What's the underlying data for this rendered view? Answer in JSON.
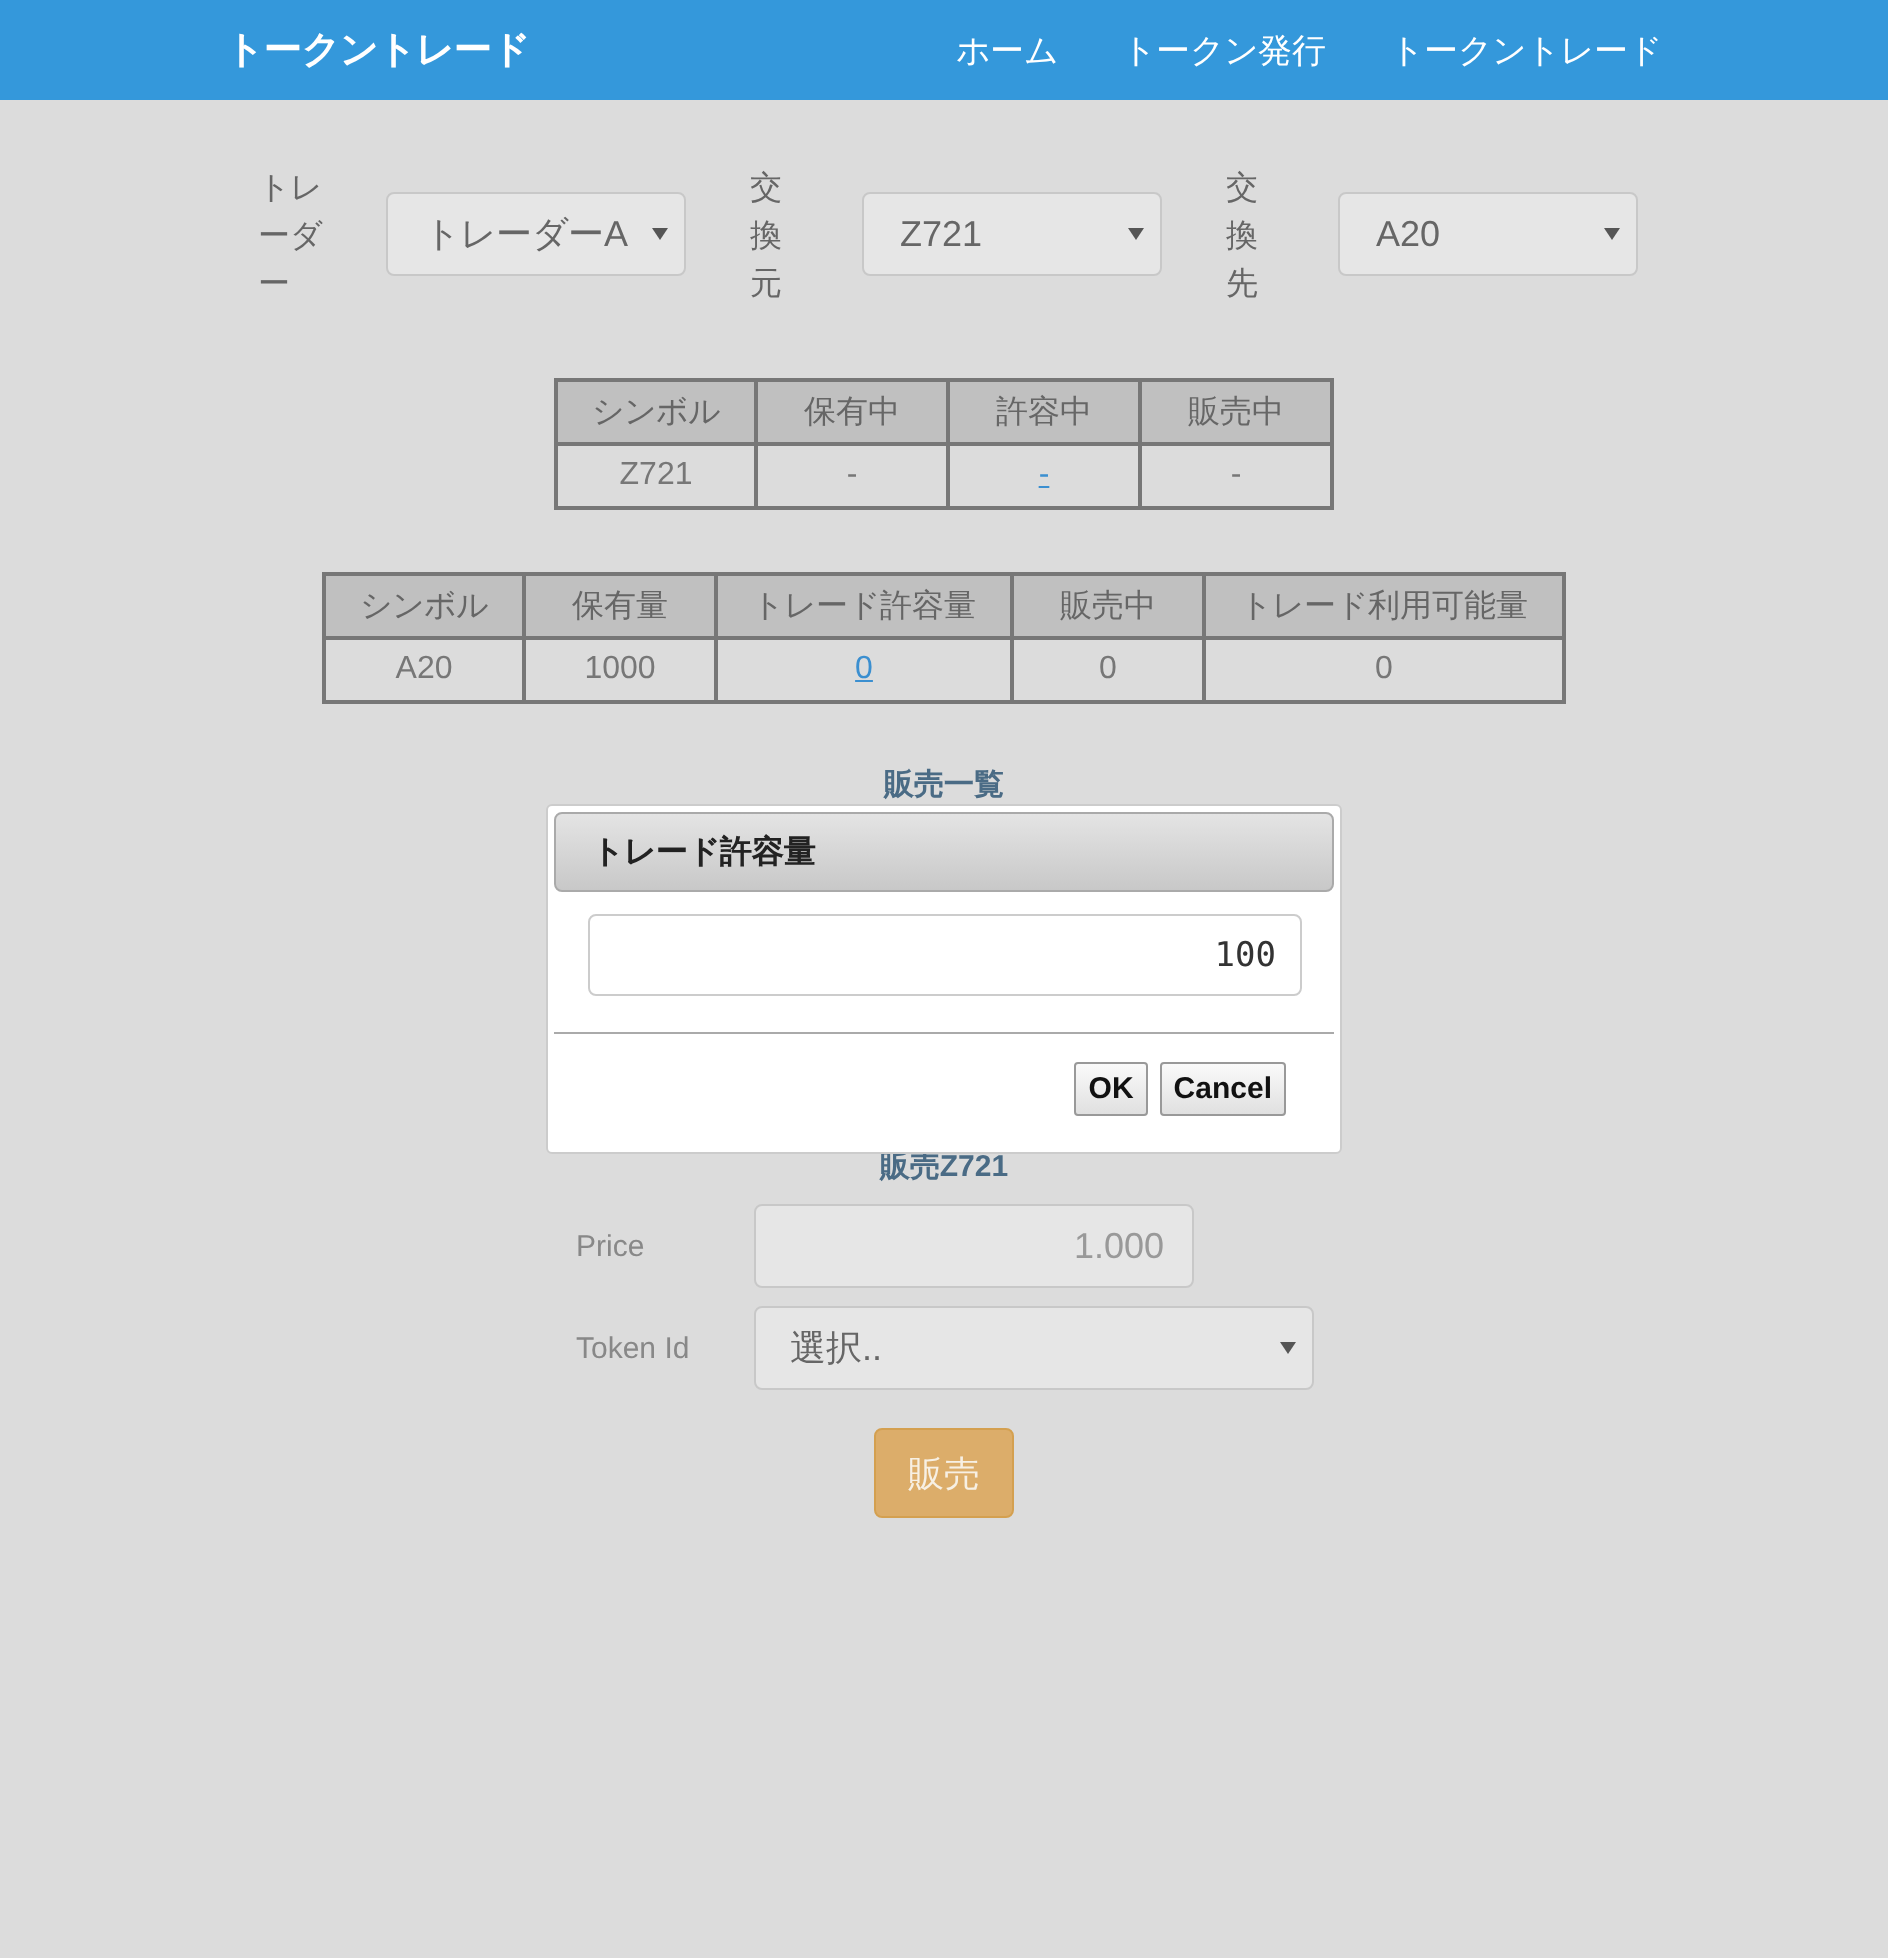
{
  "navbar": {
    "brand": "トークントレード",
    "links": [
      {
        "label": "ホーム"
      },
      {
        "label": "トークン発行"
      },
      {
        "label": "トークントレード"
      }
    ]
  },
  "selectors": [
    {
      "label": "トレーダー",
      "value": "トレーダーA"
    },
    {
      "label": "交換元",
      "value": "Z721"
    },
    {
      "label": "交換先",
      "value": "A20"
    }
  ],
  "source_table": {
    "columns": [
      "シンボル",
      "保有中",
      "許容中",
      "販売中"
    ],
    "rows": [
      [
        {
          "text": "Z721",
          "kind": "text"
        },
        {
          "text": "-",
          "kind": "text"
        },
        {
          "text": "-",
          "kind": "link"
        },
        {
          "text": "-",
          "kind": "text"
        }
      ]
    ]
  },
  "target_table": {
    "columns": [
      "シンボル",
      "保有量",
      "トレード許容量",
      "販売中",
      "トレード利用可能量"
    ],
    "rows": [
      [
        {
          "text": "A20",
          "kind": "text"
        },
        {
          "text": "1000",
          "kind": "text"
        },
        {
          "text": "0",
          "kind": "link"
        },
        {
          "text": "0",
          "kind": "text"
        },
        {
          "text": "0",
          "kind": "text"
        }
      ]
    ]
  },
  "sales_list": {
    "title": "販売一覧"
  },
  "sell_form": {
    "title": "販売Z721",
    "price_label": "Price",
    "price_value": "1.000",
    "token_label": "Token Id",
    "token_placeholder": "選択..",
    "submit": "販売"
  },
  "dialog": {
    "title": "トレード許容量",
    "value": "100",
    "buttons": [
      "OK",
      "Cancel"
    ]
  }
}
